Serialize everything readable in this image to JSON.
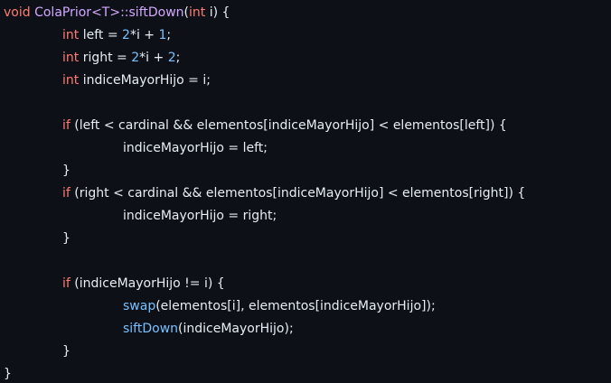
{
  "editor": {
    "language": "C++",
    "theme": {
      "background": "#0d1117",
      "text": "#e6edf3",
      "keyword": "#ff7b72",
      "function": "#d2a8ff",
      "number": "#79c0ff"
    },
    "lines": [
      {
        "tokens": [
          {
            "t": "void",
            "c": "kw"
          },
          {
            "t": " "
          },
          {
            "t": "ColaPrior<T>::siftDown",
            "c": "fn"
          },
          {
            "t": "("
          },
          {
            "t": "int",
            "c": "kw"
          },
          {
            "t": " i) {"
          }
        ]
      },
      {
        "indent": 1,
        "tokens": [
          {
            "t": "int",
            "c": "kw"
          },
          {
            "t": " left = "
          },
          {
            "t": "2",
            "c": "num"
          },
          {
            "t": "*i + "
          },
          {
            "t": "1",
            "c": "num"
          },
          {
            "t": ";"
          }
        ]
      },
      {
        "indent": 1,
        "tokens": [
          {
            "t": "int",
            "c": "kw"
          },
          {
            "t": " right = "
          },
          {
            "t": "2",
            "c": "num"
          },
          {
            "t": "*i + "
          },
          {
            "t": "2",
            "c": "num"
          },
          {
            "t": ";"
          }
        ]
      },
      {
        "indent": 1,
        "tokens": [
          {
            "t": "int",
            "c": "kw"
          },
          {
            "t": " indiceMayorHijo = i;"
          }
        ]
      },
      {
        "tokens": []
      },
      {
        "indent": 1,
        "tokens": [
          {
            "t": "if",
            "c": "kw"
          },
          {
            "t": " (left < cardinal && elementos[indiceMayorHijo] < elementos[left]) {"
          }
        ]
      },
      {
        "indent": 2,
        "tokens": [
          {
            "t": "indiceMayorHijo = left;"
          }
        ]
      },
      {
        "indent": 1,
        "tokens": [
          {
            "t": "}"
          }
        ]
      },
      {
        "indent": 1,
        "tokens": [
          {
            "t": "if",
            "c": "kw"
          },
          {
            "t": " (right < cardinal && elementos[indiceMayorHijo] < elementos[right]) {"
          }
        ]
      },
      {
        "indent": 2,
        "tokens": [
          {
            "t": "indiceMayorHijo = right;"
          }
        ]
      },
      {
        "indent": 1,
        "tokens": [
          {
            "t": "}"
          }
        ]
      },
      {
        "tokens": []
      },
      {
        "indent": 1,
        "tokens": [
          {
            "t": "if",
            "c": "kw"
          },
          {
            "t": " (indiceMayorHijo != i) {"
          }
        ]
      },
      {
        "indent": 2,
        "tokens": [
          {
            "t": "swap",
            "c": "call"
          },
          {
            "t": "(elementos[i], elementos[indiceMayorHijo]);"
          }
        ]
      },
      {
        "indent": 2,
        "tokens": [
          {
            "t": "siftDown",
            "c": "call"
          },
          {
            "t": "(indiceMayorHijo);"
          }
        ]
      },
      {
        "indent": 1,
        "tokens": [
          {
            "t": "}"
          }
        ]
      },
      {
        "tokens": [
          {
            "t": "}"
          }
        ]
      }
    ]
  }
}
